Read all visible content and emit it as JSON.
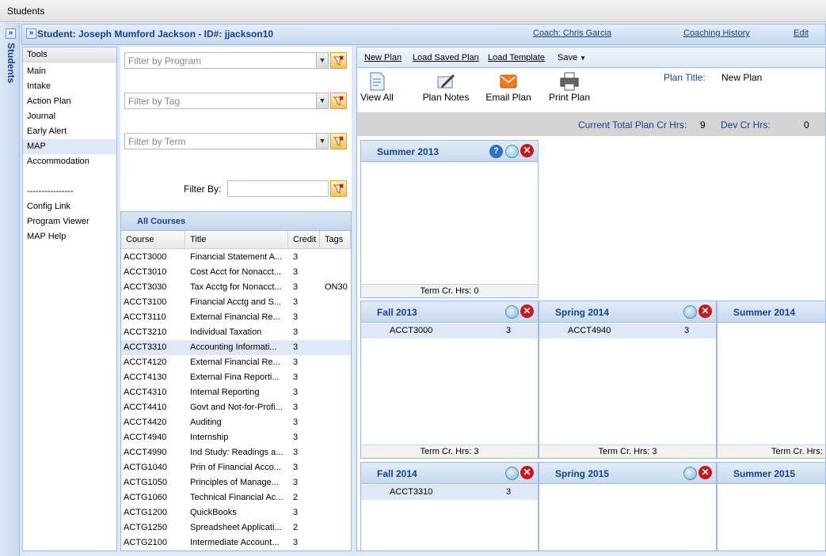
{
  "app": {
    "title": "Students"
  },
  "sidebar": {
    "label": "Students"
  },
  "header": {
    "student": "Student: Joseph Mumford Jackson - ID#: jjackson10",
    "coach": "Coach: Chris Garcia",
    "coaching_history": "Coaching History",
    "edit": "Edit"
  },
  "tools": {
    "title": "Tools",
    "items": [
      "Main",
      "Intake",
      "Action Plan",
      "Journal",
      "Early Alert",
      "MAP",
      "Accommodation",
      "",
      "----------------",
      "Config Link",
      "Program Viewer",
      "MAP Help"
    ],
    "selected": "MAP"
  },
  "filters": {
    "program_placeholder": "Filter by Program",
    "tag_placeholder": "Filter by Tag",
    "term_placeholder": "Filter by Term",
    "filter_by_label": "Filter By:"
  },
  "courses": {
    "title": "All Courses",
    "columns": [
      "Course",
      "Title",
      "Credit",
      "Tags"
    ],
    "rows": [
      [
        "ACCT3000",
        "Financial Statement A...",
        "3",
        ""
      ],
      [
        "ACCT3010",
        "Cost Acct for Nonacct...",
        "3",
        ""
      ],
      [
        "ACCT3030",
        "Tax Acctg for Nonacct...",
        "3",
        "ON30"
      ],
      [
        "ACCT3100",
        "Financial Acctg and S...",
        "3",
        ""
      ],
      [
        "ACCT3110",
        "External Financial Re...",
        "3",
        ""
      ],
      [
        "ACCT3210",
        "Individual Taxation",
        "3",
        ""
      ],
      [
        "ACCT3310",
        "Accounting Informati...",
        "3",
        ""
      ],
      [
        "ACCT4120",
        "External Financial Re...",
        "3",
        ""
      ],
      [
        "ACCT4130",
        "External Fina Reporti...",
        "3",
        ""
      ],
      [
        "ACCT4310",
        "Internal Reporting",
        "3",
        ""
      ],
      [
        "ACCT4410",
        "Govt and Not-for-Profi...",
        "3",
        ""
      ],
      [
        "ACCT4420",
        "Auditing",
        "3",
        ""
      ],
      [
        "ACCT4940",
        "Internship",
        "3",
        ""
      ],
      [
        "ACCT4990",
        "Ind Study: Readings a...",
        "3",
        ""
      ],
      [
        "ACTG1040",
        "Prin of Financial Acco...",
        "3",
        ""
      ],
      [
        "ACTG1050",
        "Principles of Manage...",
        "3",
        ""
      ],
      [
        "ACTG1060",
        "Technical Financial Ac...",
        "2",
        ""
      ],
      [
        "ACTG1200",
        "QuickBooks",
        "3",
        ""
      ],
      [
        "ACTG1250",
        "Spreadsheet Applicati...",
        "2",
        ""
      ],
      [
        "ACTG2100",
        "Intermediate Account...",
        "3",
        ""
      ]
    ],
    "selected_row": 6
  },
  "plan": {
    "toolbar": {
      "new_plan": "New Plan",
      "load_saved_plan": "Load Saved Plan",
      "load_template": "Load Template",
      "save": "Save"
    },
    "buttons": {
      "view_all": "View All",
      "plan_notes": "Plan Notes",
      "email_plan": "Email Plan",
      "print_plan": "Print Plan"
    },
    "plan_title_label": "Plan Title:",
    "plan_title_value": "New Plan",
    "total_label": "Current Total Plan Cr Hrs:",
    "total_value": "9",
    "dev_label": "Dev Cr Hrs:",
    "dev_value": "0",
    "terms": [
      {
        "name": "Summer 2013",
        "course": "",
        "credit": "",
        "footer": "Term Cr. Hrs: 0"
      },
      {
        "name": "Fall 2013",
        "course": "ACCT3000",
        "credit": "3",
        "footer": "Term Cr. Hrs: 3"
      },
      {
        "name": "Spring 2014",
        "course": "ACCT4940",
        "credit": "3",
        "footer": "Term Cr. Hrs: 3"
      },
      {
        "name": "Summer 2014",
        "course": "",
        "credit": "",
        "footer": "Term Cr. Hrs:"
      },
      {
        "name": "Fall 2014",
        "course": "ACCT3310",
        "credit": "3",
        "footer": ""
      },
      {
        "name": "Spring 2015",
        "course": "",
        "credit": "",
        "footer": ""
      },
      {
        "name": "Summer 2015",
        "course": "",
        "credit": "",
        "footer": ""
      }
    ]
  }
}
